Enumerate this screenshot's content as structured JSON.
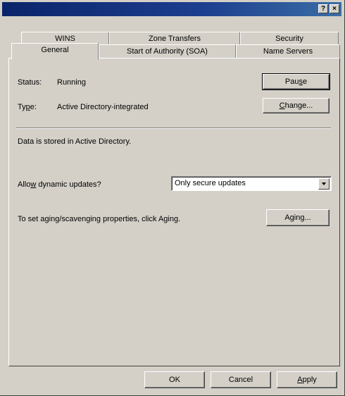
{
  "titlebar": {
    "help_label": "?",
    "close_label": "×"
  },
  "tabs_back": [
    {
      "label": "WINS"
    },
    {
      "label": "Zone Transfers"
    },
    {
      "label": "Security"
    }
  ],
  "tabs_front": [
    {
      "label": "General"
    },
    {
      "label": "Start of Authority (SOA)"
    },
    {
      "label": "Name Servers"
    }
  ],
  "general": {
    "status_label": "Status:",
    "status_value": "Running",
    "pause_button": {
      "prefix": "Pau",
      "mnemonic": "s",
      "suffix": "e"
    },
    "type_label_prefix": "Ty",
    "type_label_mnemonic": "p",
    "type_label_suffix": "e:",
    "type_value": "Active Directory-integrated",
    "change_button": {
      "mnemonic": "C",
      "suffix": "hange..."
    },
    "storage_text": "Data is stored in Active Directory.",
    "updates_label": {
      "prefix": "Allo",
      "mnemonic": "w",
      "suffix": " dynamic updates?"
    },
    "updates_select_value": "Only secure updates",
    "aging_text": "To set aging/scavenging properties, click Aging.",
    "aging_button": {
      "prefix": "A",
      "mnemonic": "g",
      "suffix": "ing..."
    }
  },
  "footer": {
    "ok_label": "OK",
    "cancel_label": "Cancel",
    "apply": {
      "mnemonic": "A",
      "suffix": "pply"
    }
  }
}
